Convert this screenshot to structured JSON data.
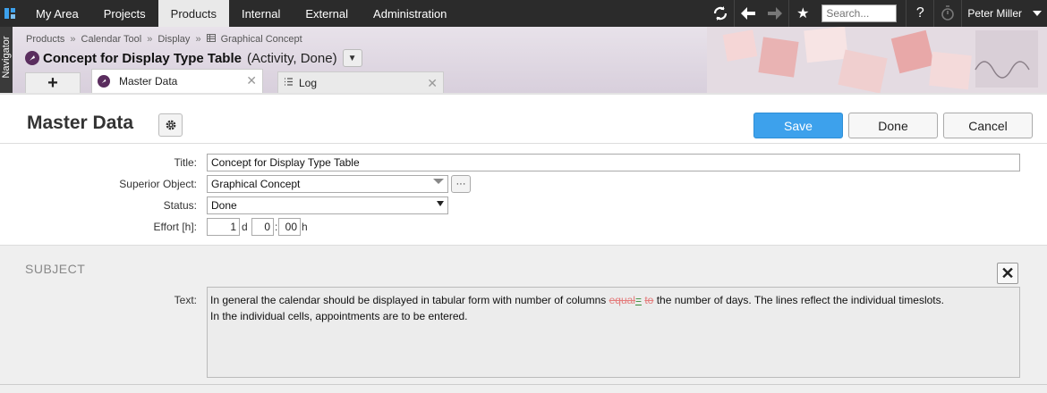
{
  "topnav": {
    "tabs": [
      "My Area",
      "Projects",
      "Products",
      "Internal",
      "External",
      "Administration"
    ],
    "active_tab": "Products",
    "search_placeholder": "Search...",
    "help_label": "?",
    "user_name": "Peter Miller"
  },
  "navigator": {
    "label": "Navigator"
  },
  "breadcrumb": [
    "Products",
    "Calendar Tool",
    "Display",
    "Graphical Concept"
  ],
  "header": {
    "title": "Concept for Display Type Table",
    "subtitle": "(Activity, Done)"
  },
  "tabs": {
    "add_label": "+",
    "master_data": "Master Data",
    "log": "Log"
  },
  "section": {
    "title": "Master Data",
    "save_label": "Save",
    "done_label": "Done",
    "cancel_label": "Cancel"
  },
  "form": {
    "title_label": "Title:",
    "title_value": "Concept for Display Type Table",
    "superior_label": "Superior Object:",
    "superior_value": "Graphical Concept",
    "ellipsis_label": "···",
    "status_label": "Status:",
    "status_value": "Done",
    "effort_label": "Effort [h]:",
    "effort_days": "1",
    "effort_days_unit": "d",
    "effort_hours": "0",
    "effort_colon": ":",
    "effort_minutes": "00",
    "effort_hours_unit": "h"
  },
  "subject": {
    "title": "SUBJECT",
    "close_label": "✕",
    "text_label": "Text:",
    "line1_a": "In general the calendar should be displayed in tabular form with number of columns ",
    "line1_del1": "equal",
    "line1_ins": "=",
    "line1_del2": "to",
    "line1_b": "the number of days. The lines reflect the individual timeslots.",
    "line2": "In the individual cells, appointments are to be entered."
  },
  "colors": {
    "topbar": "#2b2b2b",
    "accent": "#3da1ec",
    "deleted_text": "#e47b7b",
    "inserted_text": "#3a8c3a"
  }
}
